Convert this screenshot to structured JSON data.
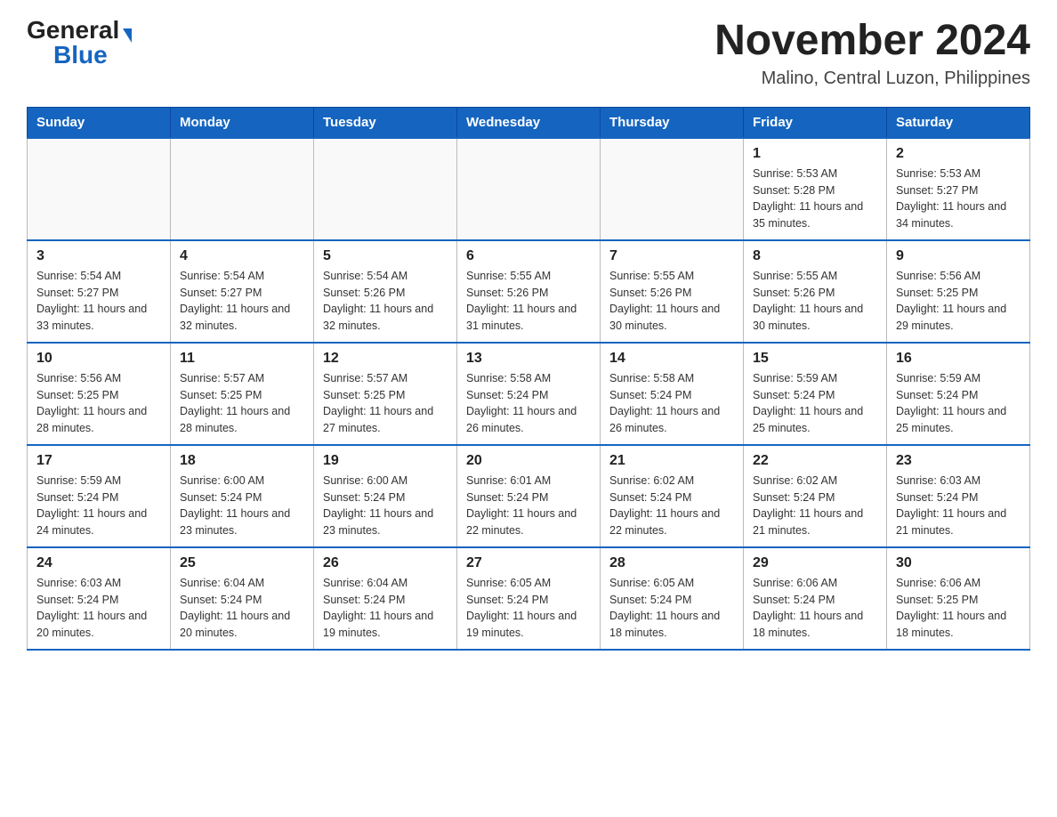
{
  "header": {
    "logo_general": "General",
    "logo_blue": "Blue",
    "title": "November 2024",
    "subtitle": "Malino, Central Luzon, Philippines"
  },
  "days_of_week": [
    "Sunday",
    "Monday",
    "Tuesday",
    "Wednesday",
    "Thursday",
    "Friday",
    "Saturday"
  ],
  "weeks": [
    [
      {
        "day": "",
        "info": ""
      },
      {
        "day": "",
        "info": ""
      },
      {
        "day": "",
        "info": ""
      },
      {
        "day": "",
        "info": ""
      },
      {
        "day": "",
        "info": ""
      },
      {
        "day": "1",
        "info": "Sunrise: 5:53 AM\nSunset: 5:28 PM\nDaylight: 11 hours and 35 minutes."
      },
      {
        "day": "2",
        "info": "Sunrise: 5:53 AM\nSunset: 5:27 PM\nDaylight: 11 hours and 34 minutes."
      }
    ],
    [
      {
        "day": "3",
        "info": "Sunrise: 5:54 AM\nSunset: 5:27 PM\nDaylight: 11 hours and 33 minutes."
      },
      {
        "day": "4",
        "info": "Sunrise: 5:54 AM\nSunset: 5:27 PM\nDaylight: 11 hours and 32 minutes."
      },
      {
        "day": "5",
        "info": "Sunrise: 5:54 AM\nSunset: 5:26 PM\nDaylight: 11 hours and 32 minutes."
      },
      {
        "day": "6",
        "info": "Sunrise: 5:55 AM\nSunset: 5:26 PM\nDaylight: 11 hours and 31 minutes."
      },
      {
        "day": "7",
        "info": "Sunrise: 5:55 AM\nSunset: 5:26 PM\nDaylight: 11 hours and 30 minutes."
      },
      {
        "day": "8",
        "info": "Sunrise: 5:55 AM\nSunset: 5:26 PM\nDaylight: 11 hours and 30 minutes."
      },
      {
        "day": "9",
        "info": "Sunrise: 5:56 AM\nSunset: 5:25 PM\nDaylight: 11 hours and 29 minutes."
      }
    ],
    [
      {
        "day": "10",
        "info": "Sunrise: 5:56 AM\nSunset: 5:25 PM\nDaylight: 11 hours and 28 minutes."
      },
      {
        "day": "11",
        "info": "Sunrise: 5:57 AM\nSunset: 5:25 PM\nDaylight: 11 hours and 28 minutes."
      },
      {
        "day": "12",
        "info": "Sunrise: 5:57 AM\nSunset: 5:25 PM\nDaylight: 11 hours and 27 minutes."
      },
      {
        "day": "13",
        "info": "Sunrise: 5:58 AM\nSunset: 5:24 PM\nDaylight: 11 hours and 26 minutes."
      },
      {
        "day": "14",
        "info": "Sunrise: 5:58 AM\nSunset: 5:24 PM\nDaylight: 11 hours and 26 minutes."
      },
      {
        "day": "15",
        "info": "Sunrise: 5:59 AM\nSunset: 5:24 PM\nDaylight: 11 hours and 25 minutes."
      },
      {
        "day": "16",
        "info": "Sunrise: 5:59 AM\nSunset: 5:24 PM\nDaylight: 11 hours and 25 minutes."
      }
    ],
    [
      {
        "day": "17",
        "info": "Sunrise: 5:59 AM\nSunset: 5:24 PM\nDaylight: 11 hours and 24 minutes."
      },
      {
        "day": "18",
        "info": "Sunrise: 6:00 AM\nSunset: 5:24 PM\nDaylight: 11 hours and 23 minutes."
      },
      {
        "day": "19",
        "info": "Sunrise: 6:00 AM\nSunset: 5:24 PM\nDaylight: 11 hours and 23 minutes."
      },
      {
        "day": "20",
        "info": "Sunrise: 6:01 AM\nSunset: 5:24 PM\nDaylight: 11 hours and 22 minutes."
      },
      {
        "day": "21",
        "info": "Sunrise: 6:02 AM\nSunset: 5:24 PM\nDaylight: 11 hours and 22 minutes."
      },
      {
        "day": "22",
        "info": "Sunrise: 6:02 AM\nSunset: 5:24 PM\nDaylight: 11 hours and 21 minutes."
      },
      {
        "day": "23",
        "info": "Sunrise: 6:03 AM\nSunset: 5:24 PM\nDaylight: 11 hours and 21 minutes."
      }
    ],
    [
      {
        "day": "24",
        "info": "Sunrise: 6:03 AM\nSunset: 5:24 PM\nDaylight: 11 hours and 20 minutes."
      },
      {
        "day": "25",
        "info": "Sunrise: 6:04 AM\nSunset: 5:24 PM\nDaylight: 11 hours and 20 minutes."
      },
      {
        "day": "26",
        "info": "Sunrise: 6:04 AM\nSunset: 5:24 PM\nDaylight: 11 hours and 19 minutes."
      },
      {
        "day": "27",
        "info": "Sunrise: 6:05 AM\nSunset: 5:24 PM\nDaylight: 11 hours and 19 minutes."
      },
      {
        "day": "28",
        "info": "Sunrise: 6:05 AM\nSunset: 5:24 PM\nDaylight: 11 hours and 18 minutes."
      },
      {
        "day": "29",
        "info": "Sunrise: 6:06 AM\nSunset: 5:24 PM\nDaylight: 11 hours and 18 minutes."
      },
      {
        "day": "30",
        "info": "Sunrise: 6:06 AM\nSunset: 5:25 PM\nDaylight: 11 hours and 18 minutes."
      }
    ]
  ]
}
